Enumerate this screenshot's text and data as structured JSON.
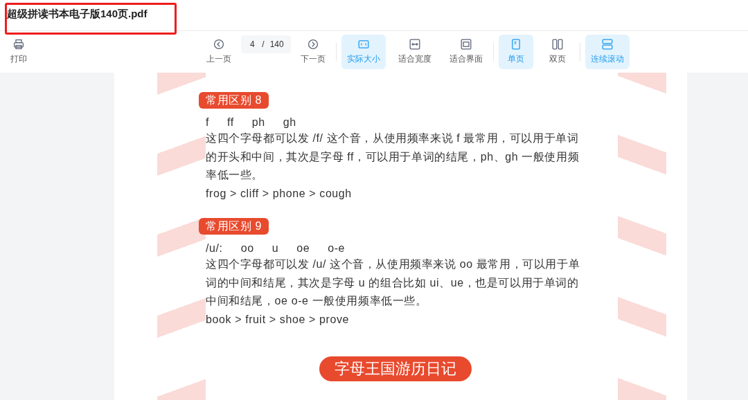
{
  "window": {
    "title": "超级拼读书本电子版140页.pdf"
  },
  "toolbar": {
    "print": {
      "label": "打印"
    },
    "prev": {
      "label": "上一页"
    },
    "page": {
      "current": "4",
      "separator": "/",
      "total": "140"
    },
    "next": {
      "label": "下一页"
    },
    "groups": [
      [
        {
          "kind": "actual-size",
          "label": "实际大小",
          "selected": true
        },
        {
          "kind": "fit-width",
          "label": "适合宽度",
          "selected": false
        },
        {
          "kind": "fit-page",
          "label": "适合界面",
          "selected": false
        }
      ],
      [
        {
          "kind": "single",
          "label": "单页",
          "selected": true
        },
        {
          "kind": "double",
          "label": "双页",
          "selected": false
        }
      ],
      [
        {
          "kind": "continuous",
          "label": "连续滚动",
          "selected": true
        }
      ]
    ]
  },
  "document": {
    "sections": [
      {
        "tag": "常用区别 8",
        "letters": [
          "f",
          "ff",
          "ph",
          "gh"
        ],
        "body": "这四个字母都可以发 /f/ 这个音，从使用频率来说 f 最常用，可以用于单词的开头和中间，其次是字母 ff，可以用于单词的结尾，ph、gh 一般使用频率低一些。",
        "examples": "frog > cliff > phone > cough"
      },
      {
        "tag": "常用区别 9",
        "letters": [
          "/u/:",
          "oo",
          "u",
          "oe",
          "o-e"
        ],
        "body": "这四个字母都可以发 /u/ 这个音，从使用频率来说 oo 最常用，可以用于单词的中间和结尾，其次是字母 u 的组合比如 ui、ue，也是可以用于单词的中间和结尾，oe o-e 一般使用频率低一些。",
        "examples": "book > fruit > shoe > prove"
      }
    ],
    "banner": "字母王国游历日记"
  }
}
